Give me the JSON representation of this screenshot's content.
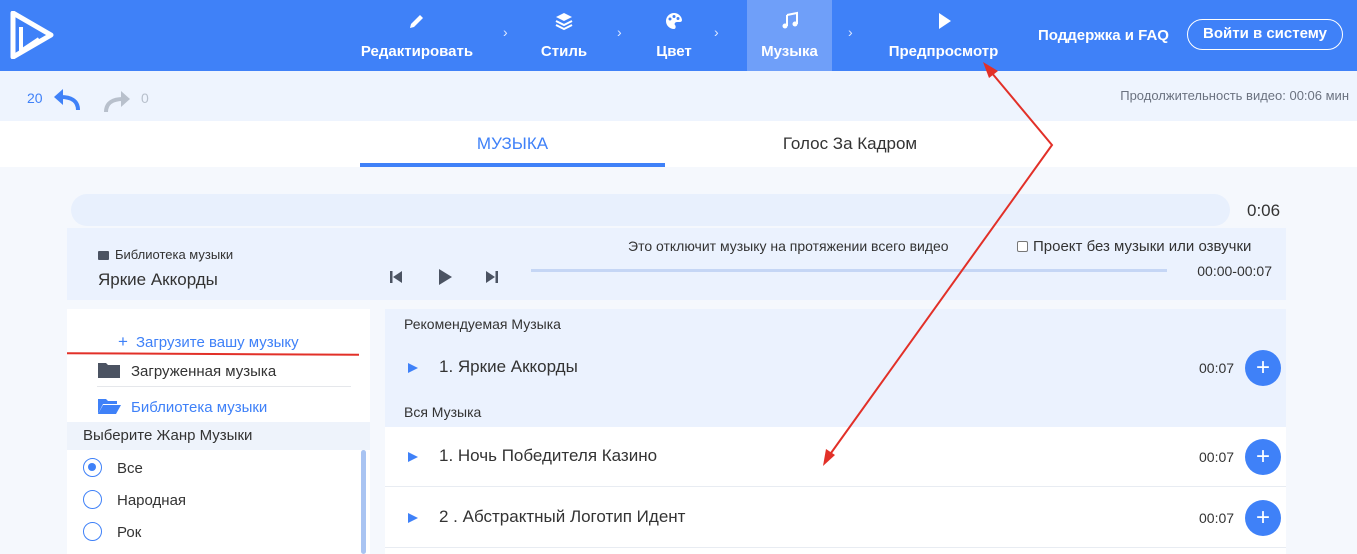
{
  "nav": {
    "steps": [
      {
        "label": "Редактировать",
        "icon": "pencil-icon"
      },
      {
        "label": "Стиль",
        "icon": "layers-icon"
      },
      {
        "label": "Цвет",
        "icon": "palette-icon"
      },
      {
        "label": "Музыка",
        "icon": "music-note-icon",
        "active": true
      },
      {
        "label": "Предпросмотр",
        "icon": "play-icon"
      }
    ],
    "separator": "›",
    "support": "Поддержка и FAQ",
    "login": "Войти в систему"
  },
  "toolbar": {
    "undo_count": "20",
    "redo_count": "0",
    "duration": "Продолжительность видео: 00:06 мин"
  },
  "tabs": [
    "МУЗЫКА",
    "Голос За Кадром"
  ],
  "progress": {
    "time": "0:06"
  },
  "player": {
    "library_label": "Библиотека музыки",
    "track": "Яркие Аккорды",
    "note": "Это отключит музыку на протяжении всего видео",
    "no_music": "Проект без музыки или озвучки",
    "range": "00:00-00:07"
  },
  "left": {
    "upload": "Загрузите вашу музыку",
    "uploaded": "Загруженная музыка",
    "library": "Библиотека музыки",
    "genre_title": "Выберите Жанр Музыки",
    "genres": [
      {
        "label": "Все",
        "selected": true
      },
      {
        "label": "Народная",
        "selected": false
      },
      {
        "label": "Рок",
        "selected": false
      }
    ]
  },
  "list": {
    "recommended_title": "Рекомендуемая Музыка",
    "recommended": [
      {
        "name": "1. Яркие Аккорды",
        "duration": "00:07"
      }
    ],
    "all_title": "Вся Музыка",
    "all": [
      {
        "name": "1. Ночь Победителя Казино",
        "duration": "00:07"
      },
      {
        "name": "2 . Абстрактный Логотип Идент",
        "duration": "00:07"
      }
    ]
  },
  "colors": {
    "brand": "#3f81f8",
    "annotation": "#e23028"
  }
}
